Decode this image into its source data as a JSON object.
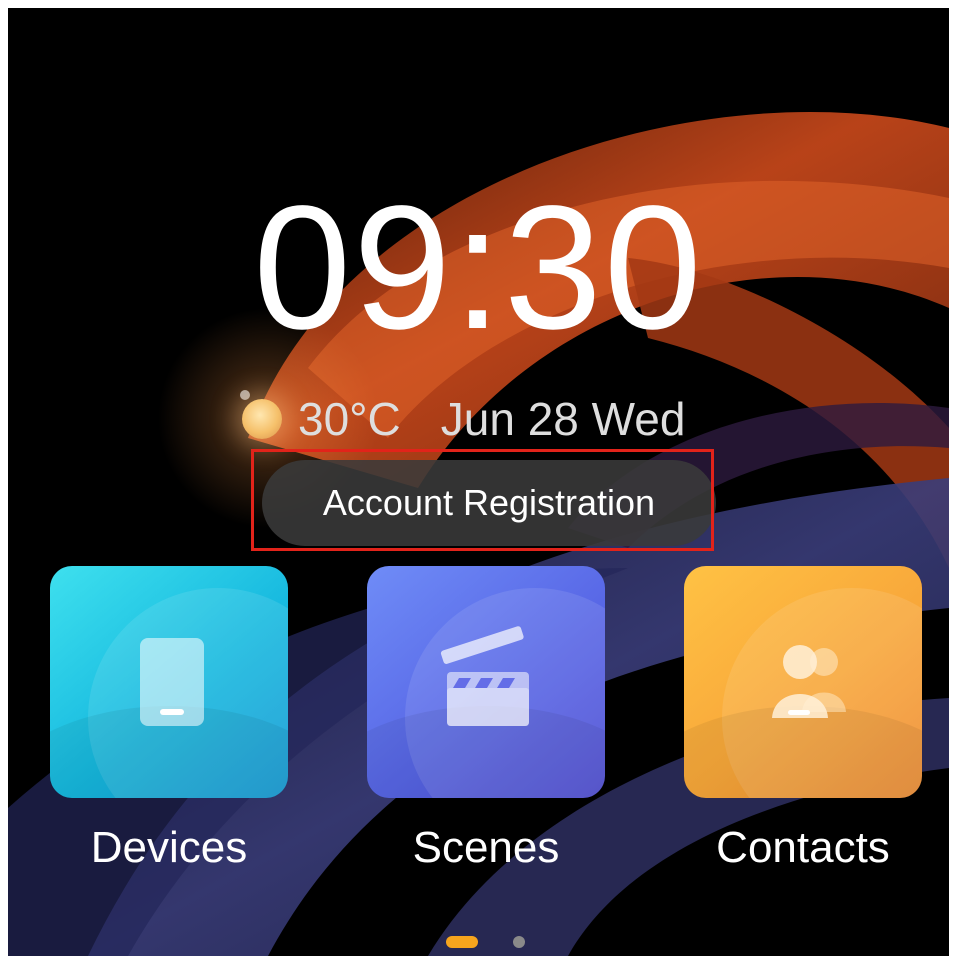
{
  "clock": {
    "time": "09:30"
  },
  "weather": {
    "icon": "sun-icon",
    "temperature": "30°C"
  },
  "date": "Jun 28 Wed",
  "account_button": {
    "label": "Account Registration",
    "highlight_color": "#e2231a"
  },
  "apps": [
    {
      "label": "Devices",
      "icon": "tablet-icon",
      "color": "#17b9df"
    },
    {
      "label": "Scenes",
      "icon": "clapperboard-icon",
      "color": "#5867e6"
    },
    {
      "label": "Contacts",
      "icon": "contacts-icon",
      "color": "#f8a73a"
    }
  ],
  "pager": {
    "page_count": 2,
    "current_page": 1,
    "active_color": "#f7a51d"
  }
}
